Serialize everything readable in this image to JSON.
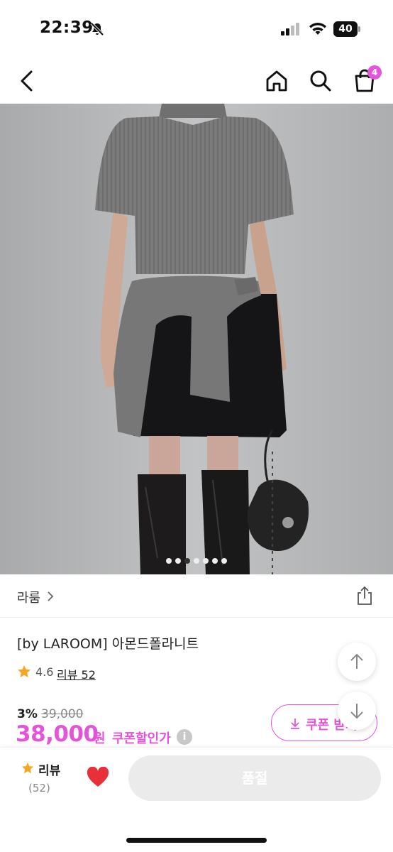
{
  "status_bar": {
    "time": "22:39",
    "battery": "40"
  },
  "nav": {
    "cart_count": "4"
  },
  "icons": {
    "back": "chevron-left-icon",
    "home": "home-icon",
    "search": "search-icon",
    "cart": "shopping-bag-icon",
    "share": "share-icon",
    "star": "star-icon",
    "heart": "heart-icon",
    "download": "download-icon",
    "info": "info-icon"
  },
  "gallery": {
    "total_images": 7,
    "active_index": 2
  },
  "brand": {
    "name": "라룸"
  },
  "product": {
    "title": "[by LAROOM] 아몬드폴라니트",
    "rating": "4.6",
    "review_label": "리뷰 52",
    "discount": "3%",
    "original_price": "39,000",
    "price": "38,000",
    "price_unit": "원",
    "coupon_price_label": "쿠폰할인가",
    "info_glyph": "i",
    "coupon_button": "쿠폰 받기"
  },
  "bottom_bar": {
    "review_label": "리뷰",
    "review_count": "(52)",
    "soldout_label": "품절"
  },
  "colors": {
    "accent": "#e553d8",
    "star": "#f5a623",
    "heart": "#e8303a"
  }
}
